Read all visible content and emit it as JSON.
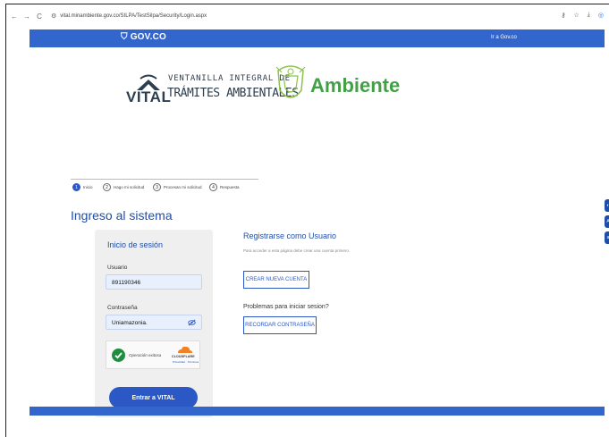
{
  "browser": {
    "back": "←",
    "forward": "→",
    "reload": "C",
    "url": "vital.minambiente.gov.co/SILPA/TestSilpa/Security/Login.aspx",
    "icons": [
      "key-icon",
      "star-icon",
      "download-icon",
      "extension-icon"
    ]
  },
  "gov_bar": {
    "logo": "GOV.CO",
    "link": "Ir a Gov.co",
    "color": "#3366cc"
  },
  "vital_logo": {
    "line1": "VENTANILLA INTEGRAL DE",
    "word": "VITAL",
    "line2": "TRÁMITES AMBIENTALES"
  },
  "ambiente_logo": {
    "word": "Ambiente",
    "color": "#43a047"
  },
  "stepper": {
    "steps": [
      {
        "num": "1",
        "label": "Inicio"
      },
      {
        "num": "2",
        "label": "Hago mi solicitud"
      },
      {
        "num": "3",
        "label": "Procesan mi solicitud"
      },
      {
        "num": "4",
        "label": "Respuesta"
      }
    ]
  },
  "page_title": "Ingreso al sistema",
  "login": {
    "title": "Inicio de sesión",
    "user_label": "Usuario",
    "user_value": "891190346",
    "password_label": "Contraseña",
    "password_value": "Uniamazonia.",
    "captcha_text": "Operación exitosa",
    "captcha_brand": "CLOUDFLARE",
    "captcha_links": "Privacidad · Términos",
    "enter_button": "Entrar a VITAL"
  },
  "register": {
    "title": "Registrarse como Usuario",
    "desc": "Para acceder a esta página debe crear una cuenta primero.",
    "create_button": "CREAR NUEVA CUENTA",
    "help_title": "Problemas para iniciar sesion?",
    "recover_button": "RECORDAR CONTRASEÑA"
  },
  "accent_color": "#2b58c4"
}
